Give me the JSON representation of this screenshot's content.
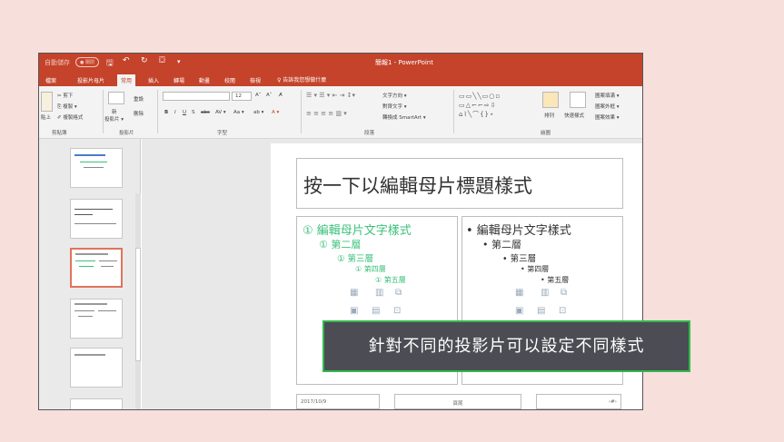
{
  "titlebar": {
    "autosave": "自動儲存",
    "autosave_state": "● 關閉",
    "save": "🖫",
    "undo": "↶",
    "redo": "↻",
    "present": "⛋",
    "more": "▾",
    "doc_title": "簡報1 - PowerPoint"
  },
  "tabs": [
    "檔案",
    "投影片母片",
    "常用",
    "插入",
    "轉場",
    "動畫",
    "校閱",
    "檢視"
  ],
  "active_tab": "常用",
  "tell_me": "♀ 告訴我您想做什麼",
  "ribbon": {
    "clipboard": {
      "paste": "貼上",
      "cut": "✂ 剪下",
      "copy": "⎘ 複製 ▾",
      "format_painter": "✐ 複製格式",
      "label": "剪貼簿"
    },
    "slides": {
      "new_slide": "新",
      "new_slide2": "投影片 ▾",
      "reset": "重設",
      "delete": "刪除",
      "label": "投影片"
    },
    "font": {
      "font_name": "",
      "font_size": "12",
      "grow": "A˄",
      "shrink": "A˅",
      "clear": "A̸",
      "bold": "B",
      "italic": "I",
      "underline": "U",
      "strike": "S",
      "strike2": "abc",
      "spacing": "AV ▾",
      "case": "Aa ▾",
      "highlight": "ab ▾",
      "color": "A ▾",
      "label": "字型"
    },
    "paragraph": {
      "text_direction": "文字方向 ▾",
      "align_text": "對齊文字 ▾",
      "smartart": "轉換成 SmartArt ▾",
      "label": "段落"
    },
    "drawing": {
      "arrange": "排列",
      "quick_styles": "快速樣式",
      "shape_fill": "圖案填滿 ▾",
      "shape_outline": "圖案外框 ▾",
      "shape_effects": "圖案效果 ▾",
      "label": "繪圖"
    }
  },
  "thumbnails": [
    {
      "title": "按一下以編輯母片標題樣式"
    },
    {
      "title": "按一下以編輯母片標題樣式"
    },
    {
      "title": "按一下以編輯母片標題樣式"
    },
    {
      "title": "按一下以編輯母片標題樣式"
    },
    {
      "title": "按一下以編輯母片標題樣式"
    },
    {
      "title": ""
    }
  ],
  "slide": {
    "title": "按一下以編輯母片標題樣式",
    "left_levels": [
      "① 編輯母片文字樣式",
      "① 第二層",
      "① 第三層",
      "① 第四層",
      "① 第五層"
    ],
    "right_levels": [
      "• 編輯母片文字樣式",
      "• 第二層",
      "• 第三層",
      "• 第四層",
      "• 第五層"
    ],
    "footer_date": "2017/10/9",
    "footer_text": "頁尾",
    "footer_num": "‹#›"
  },
  "caption": "針對不同的投影片可以設定不同樣式",
  "colors": {
    "accent": "#c4432a",
    "green_bullet": "#3ac17a",
    "caption_bg": "#4c4c54",
    "caption_border": "#32b84a"
  }
}
